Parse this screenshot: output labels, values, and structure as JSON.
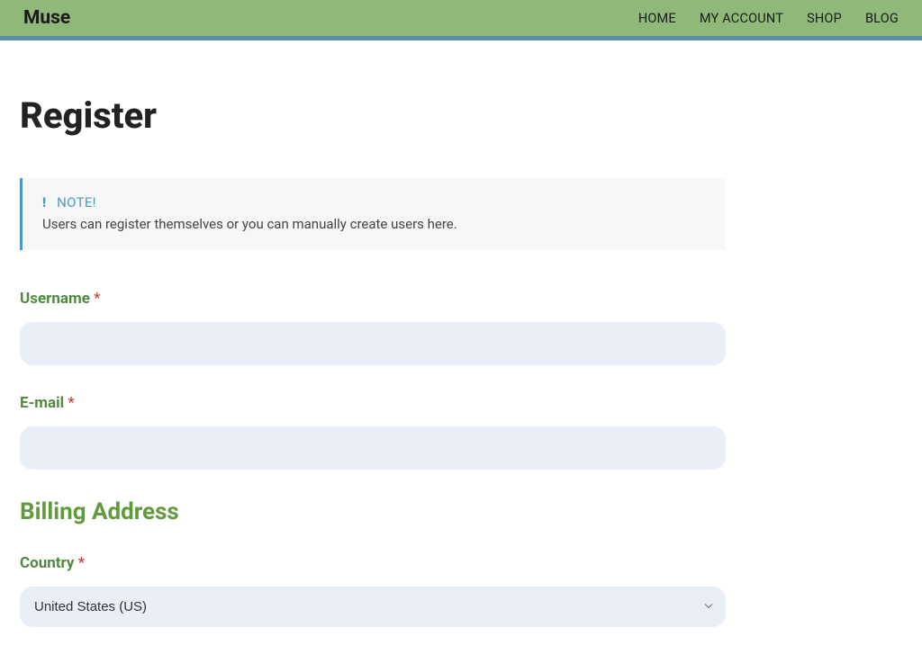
{
  "header": {
    "logo": "Muse",
    "nav": {
      "home": "HOME",
      "my_account": "MY ACCOUNT",
      "shop": "SHOP",
      "blog": "BLOG"
    }
  },
  "page": {
    "title": "Register"
  },
  "note": {
    "title": "NOTE!",
    "text": "Users can register themselves or you can manually create users here."
  },
  "form": {
    "username": {
      "label": "Username ",
      "value": ""
    },
    "email": {
      "label": "E-mail ",
      "value": ""
    },
    "billing_section": "Billing Address",
    "country": {
      "label": "Country ",
      "selected": "United States (US)"
    },
    "required_marker": "*"
  }
}
